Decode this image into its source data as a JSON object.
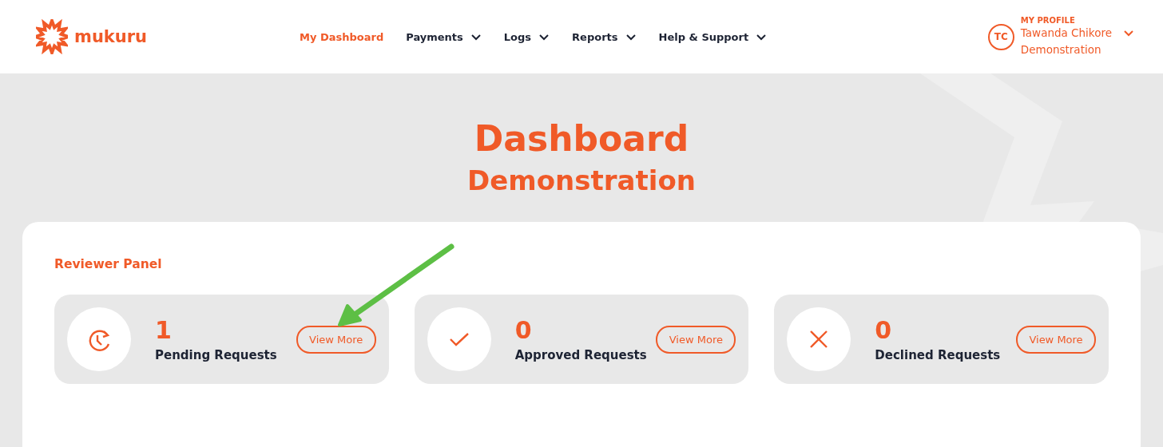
{
  "header": {
    "brand": "mukuru",
    "nav": [
      {
        "label": "My Dashboard",
        "selected": true,
        "kind": "link"
      },
      {
        "label": "Payments",
        "selected": false,
        "kind": "dropdown"
      },
      {
        "label": "Logs",
        "selected": false,
        "kind": "dropdown"
      },
      {
        "label": "Reports",
        "selected": false,
        "kind": "dropdown"
      },
      {
        "label": "Help & Support",
        "selected": false,
        "kind": "dropdown"
      }
    ],
    "profile": {
      "caption": "MY PROFILE",
      "initials": "TC",
      "name": "Tawanda Chikore",
      "organisation": "Demonstration"
    }
  },
  "title": "Dashboard",
  "subtitle": "Demonstration",
  "panel": {
    "heading": "Reviewer Panel",
    "cards": [
      {
        "kind": "pending",
        "count": "1",
        "label": "Pending Requests",
        "button": "View More",
        "annotated": true
      },
      {
        "kind": "approved",
        "count": "0",
        "label": "Approved Requests",
        "button": "View More",
        "annotated": false
      },
      {
        "kind": "declined",
        "count": "0",
        "label": "Declined Requests",
        "button": "View More",
        "annotated": false
      }
    ]
  }
}
